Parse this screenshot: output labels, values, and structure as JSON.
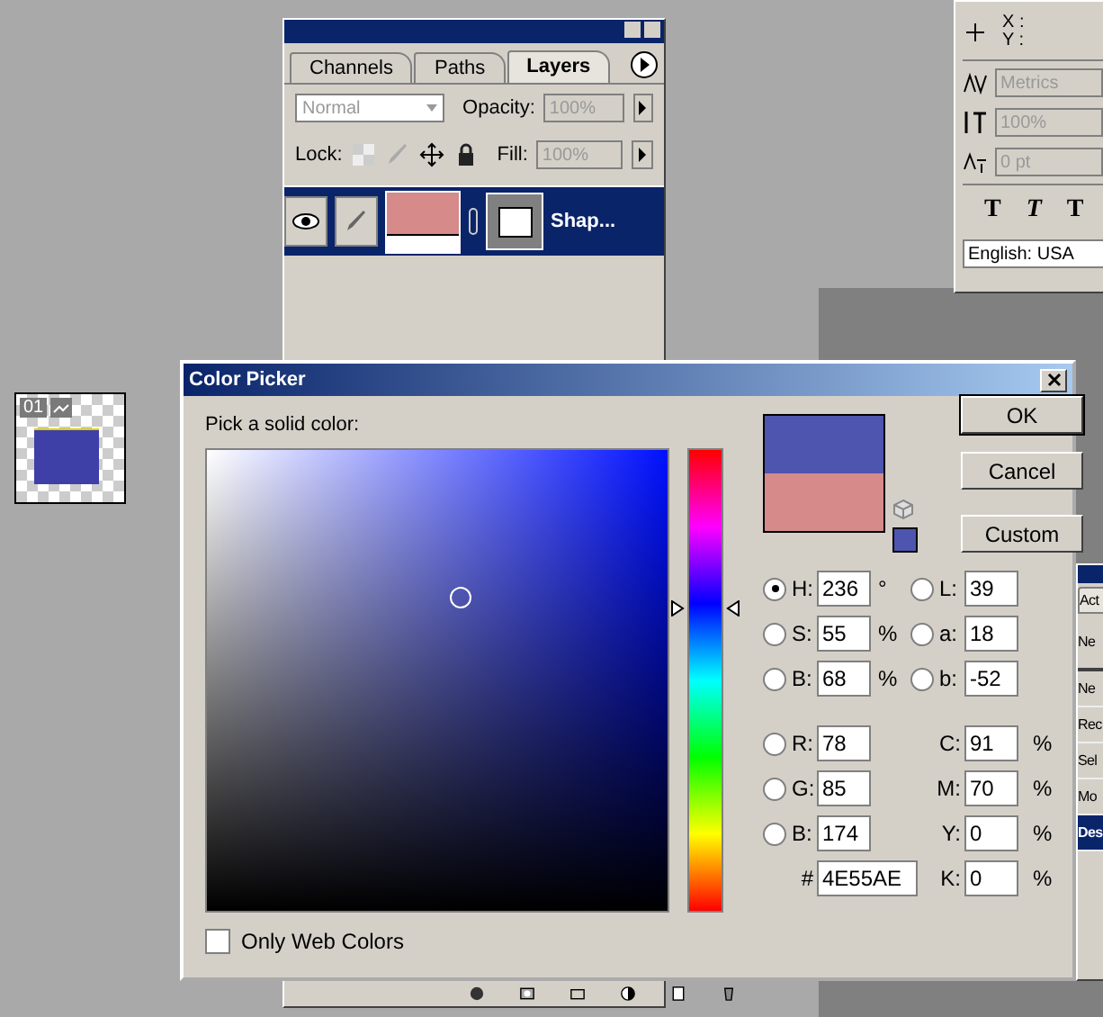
{
  "document_thumbnail": {
    "label": "01"
  },
  "layers_panel": {
    "tabs": [
      {
        "label": "Channels",
        "selected": false
      },
      {
        "label": "Paths",
        "selected": false
      },
      {
        "label": "Layers",
        "selected": true
      }
    ],
    "blend_mode": "Normal",
    "opacity_label": "Opacity:",
    "opacity": "100%",
    "lock_label": "Lock:",
    "fill_label": "Fill:",
    "fill": "100%",
    "layers": [
      {
        "name": "Shap...",
        "selected": true,
        "visible": true
      }
    ]
  },
  "character_panel": {
    "x_label": "X :",
    "y_label": "Y :",
    "kerning": "Metrics",
    "scale": "100%",
    "baseline": "0 pt",
    "style_buttons": [
      "T",
      "T",
      "T"
    ],
    "language": "English: USA"
  },
  "actions_panel": {
    "tab": "Act",
    "items": [
      {
        "label": "Ne",
        "selected": false
      },
      {
        "label": "Ne",
        "selected": false
      },
      {
        "label": "Rec",
        "selected": false
      },
      {
        "label": "Sel",
        "selected": false
      },
      {
        "label": "Mo",
        "selected": false
      },
      {
        "label": "Des",
        "selected": true
      }
    ]
  },
  "color_picker": {
    "title": "Color Picker",
    "prompt": "Pick a solid color:",
    "hue_slider": {
      "level": 0.656
    },
    "swatches": [
      {
        "kind": "new",
        "color": "#4e55ae"
      },
      {
        "kind": "current",
        "color": "#d68a8a"
      }
    ],
    "buttons": [
      "OK",
      "Cancel",
      "Custom"
    ],
    "hsb_fields": [
      {
        "label": "H:",
        "value": "236",
        "unit": "°",
        "selected": true
      },
      {
        "label": "S:",
        "value": "55",
        "unit": "%",
        "selected": false
      },
      {
        "label": "B:",
        "value": "68",
        "unit": "%",
        "selected": false
      }
    ],
    "lab_fields": [
      {
        "label": "L:",
        "value": "39",
        "selected": false
      },
      {
        "label": "a:",
        "value": "18",
        "selected": false
      },
      {
        "label": "b:",
        "value": "-52",
        "selected": false
      }
    ],
    "rgb_fields": [
      {
        "label": "R:",
        "value": "78",
        "selected": false
      },
      {
        "label": "G:",
        "value": "85",
        "selected": false
      },
      {
        "label": "B:",
        "value": "174",
        "selected": false
      }
    ],
    "cmyk_fields": [
      {
        "label": "C:",
        "value": "91",
        "unit": "%"
      },
      {
        "label": "M:",
        "value": "70",
        "unit": "%"
      },
      {
        "label": "Y:",
        "value": "0",
        "unit": "%"
      },
      {
        "label": "K:",
        "value": "0",
        "unit": "%"
      }
    ],
    "hex": {
      "label": "#",
      "value": "4E55AE"
    },
    "web_colors": {
      "label": "Only Web Colors",
      "checked": false
    }
  }
}
